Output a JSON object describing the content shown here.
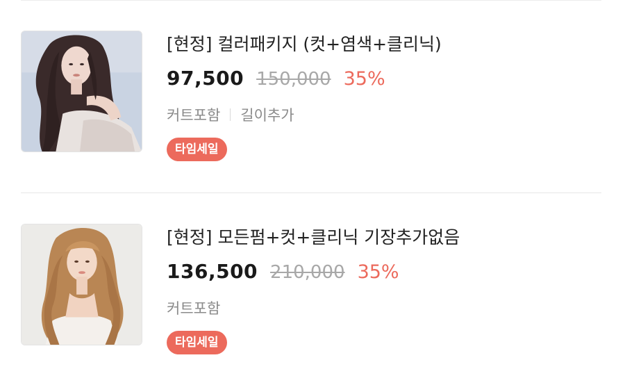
{
  "products": [
    {
      "title": "[현정] 컬러패키지 (컷+염색+클리닉)",
      "price": "97,500",
      "original_price": "150,000",
      "discount": "35%",
      "options": [
        "커트포함",
        "길이추가"
      ],
      "badge": "타임세일",
      "image_alt": "woman with long dark wavy hair",
      "colors": {
        "bg": "#c9d3e2",
        "hair": "#3a2a2a",
        "skin": "#efd8cf"
      }
    },
    {
      "title": "[현정] 모든펌+컷+클리닉 기장추가없음",
      "price": "136,500",
      "original_price": "210,000",
      "discount": "35%",
      "options": [
        "커트포함"
      ],
      "badge": "타임세일",
      "image_alt": "woman with long blonde wavy hair",
      "colors": {
        "bg": "#ecebe8",
        "hair": "#b98654",
        "skin": "#f3d9c8"
      }
    }
  ],
  "theme": {
    "accent": "#ec6a5c",
    "strike_gray": "#a8a8a8",
    "option_gray": "#8a8a8a"
  }
}
